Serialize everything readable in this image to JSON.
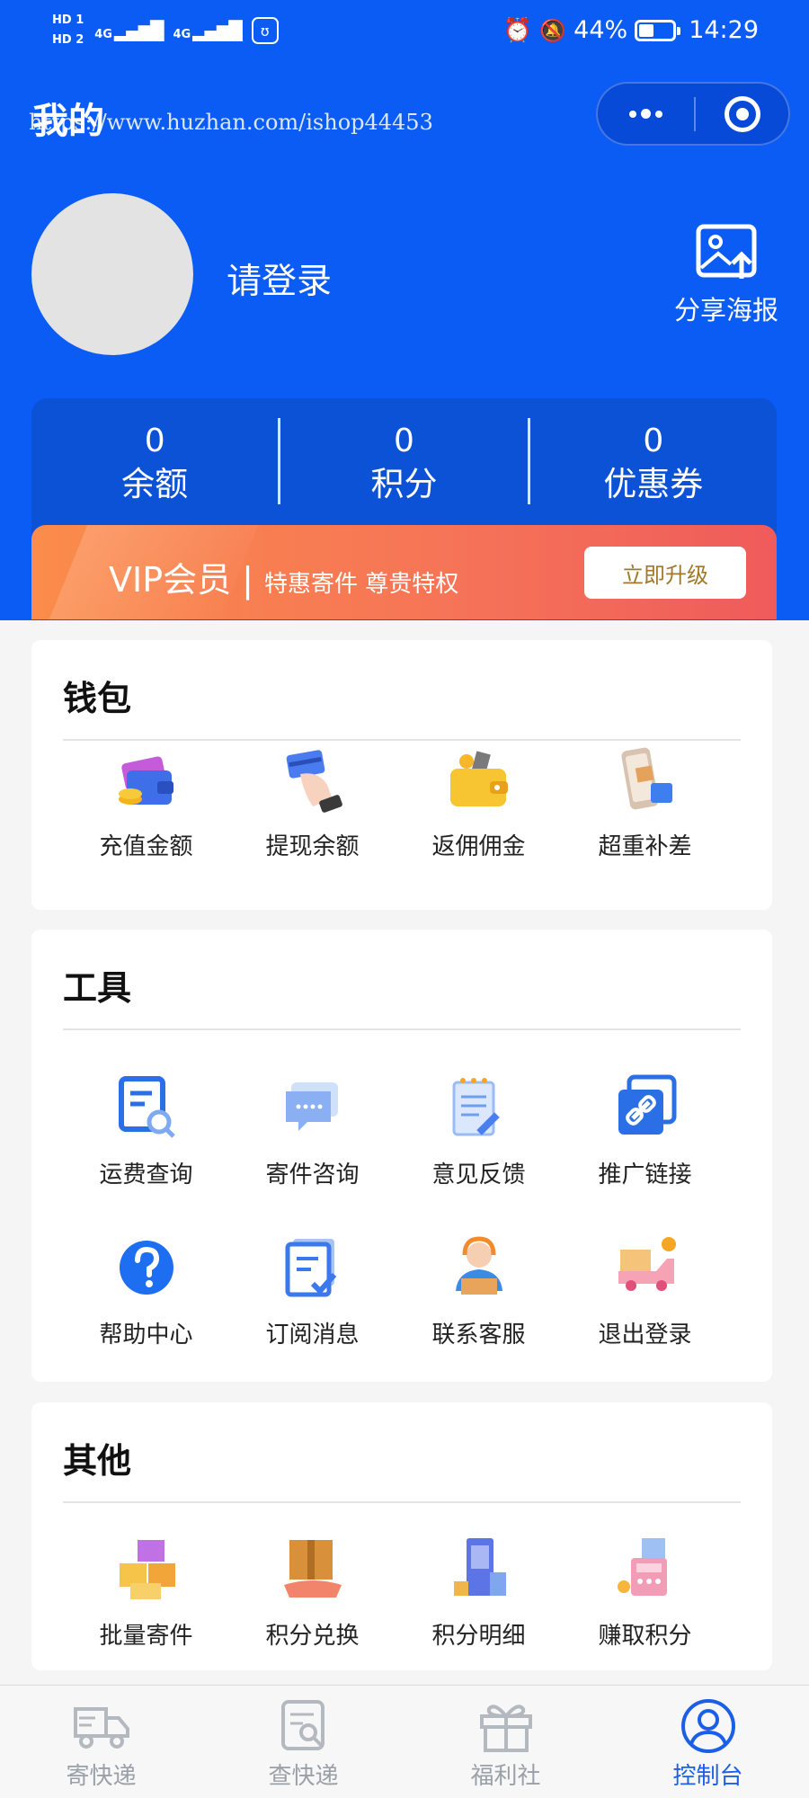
{
  "status_bar": {
    "hd1": "HD 1",
    "hd2": "HD 2",
    "net1": "4G",
    "net2": "4G",
    "battery_percent": "44%",
    "battery_level": 0.44,
    "time": "14:29"
  },
  "header": {
    "title": "我的",
    "watermark": "https://www.huzhan.com/ishop44453"
  },
  "profile": {
    "login_prompt": "请登录",
    "share_label": "分享海报"
  },
  "stats": [
    {
      "value": "0",
      "label": "余额"
    },
    {
      "value": "0",
      "label": "积分"
    },
    {
      "value": "0",
      "label": "优惠券"
    }
  ],
  "vip": {
    "title": "VIP会员",
    "separator": "|",
    "subtitle": "特惠寄件 尊贵特权",
    "button": "立即升级"
  },
  "sections": {
    "wallet": {
      "title": "钱包",
      "items": [
        {
          "label": "充值金额",
          "icon": "wallet-coins-icon"
        },
        {
          "label": "提现余额",
          "icon": "card-hand-icon"
        },
        {
          "label": "返佣佣金",
          "icon": "commission-wallet-icon"
        },
        {
          "label": "超重补差",
          "icon": "phone-package-icon"
        }
      ]
    },
    "tools": {
      "title": "工具",
      "items": [
        {
          "label": "运费查询",
          "icon": "freight-search-icon"
        },
        {
          "label": "寄件咨询",
          "icon": "chat-bubble-icon"
        },
        {
          "label": "意见反馈",
          "icon": "feedback-notepad-icon"
        },
        {
          "label": "推广链接",
          "icon": "link-icon"
        },
        {
          "label": "帮助中心",
          "icon": "help-icon"
        },
        {
          "label": "订阅消息",
          "icon": "subscribe-doc-icon"
        },
        {
          "label": "联系客服",
          "icon": "customer-service-icon"
        },
        {
          "label": "退出登录",
          "icon": "logout-truck-icon"
        }
      ]
    },
    "other": {
      "title": "其他",
      "items": [
        {
          "label": "批量寄件",
          "icon": "boxes-icon"
        },
        {
          "label": "积分兑换",
          "icon": "box-exchange-icon"
        },
        {
          "label": "积分明细",
          "icon": "points-detail-icon"
        },
        {
          "label": "赚取积分",
          "icon": "earn-points-icon"
        }
      ]
    }
  },
  "tabbar": [
    {
      "label": "寄快递",
      "icon": "truck-icon",
      "active": false
    },
    {
      "label": "查快递",
      "icon": "search-doc-icon",
      "active": false
    },
    {
      "label": "福利社",
      "icon": "gift-icon",
      "active": false
    },
    {
      "label": "控制台",
      "icon": "user-icon",
      "active": true
    }
  ],
  "colors": {
    "primary": "#0a5cf5",
    "vip_start": "#fb8c4a",
    "vip_end": "#ef5b5b",
    "tab_active": "#1a5fe6",
    "tab_inactive": "#9aa0a8"
  }
}
